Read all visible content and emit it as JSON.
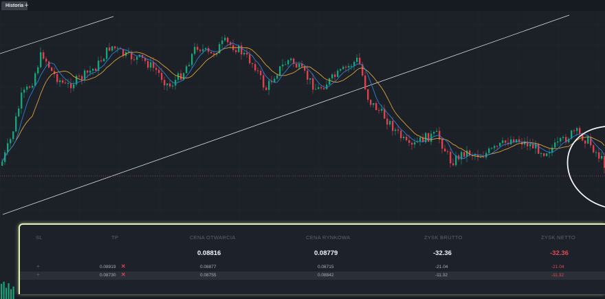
{
  "tabs": [
    {
      "label": "Historia"
    }
  ],
  "tab_add_label": "+",
  "positions": {
    "headers": [
      "SL",
      "TP",
      "CENA OTWARCIA",
      "CENA RYNKOWA",
      "ZYSK BRUTTO",
      "ZYSK NETTO"
    ],
    "summary": {
      "cena_otwarcia": "0.08816",
      "cena_rynkowa": "0.08779",
      "zysk_brutto": "-32.36",
      "zysk_netto": "-32.36"
    },
    "rows": [
      {
        "sl": "+",
        "tp": "0.08919",
        "cena_otwarcia": "0.08877",
        "cena_rynkowa": "0.08715",
        "zysk_brutto": "-21.04",
        "zysk_netto": "-21.04"
      },
      {
        "sl": "+",
        "tp": "0.08730",
        "cena_otwarcia": "0.08755",
        "cena_rynkowa": "0.08842",
        "zysk_brutto": "-11.32",
        "zysk_netto": "-11.32"
      }
    ],
    "close_icon": "x-icon"
  },
  "colors": {
    "up": "#1aa37a",
    "down": "#e0414e",
    "ma_fast": "#2f7fd6",
    "ma_slow": "#e0a23a",
    "highlight": "#e9f0b5"
  }
}
